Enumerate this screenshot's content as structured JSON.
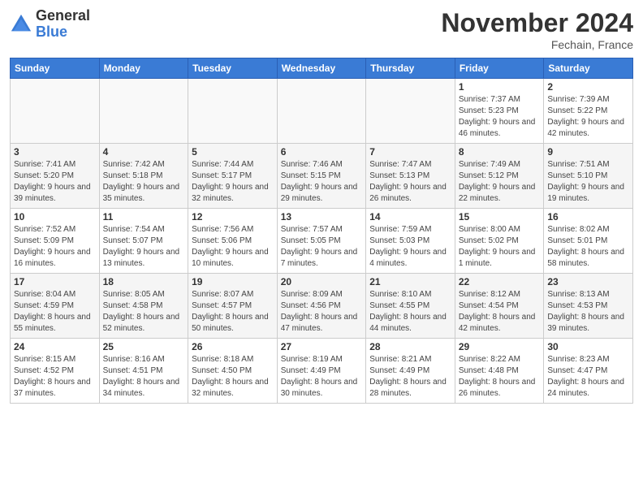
{
  "header": {
    "logo": {
      "general": "General",
      "blue": "Blue"
    },
    "title": "November 2024",
    "location": "Fechain, France"
  },
  "weekdays": [
    "Sunday",
    "Monday",
    "Tuesday",
    "Wednesday",
    "Thursday",
    "Friday",
    "Saturday"
  ],
  "weeks": [
    [
      {
        "day": "",
        "info": ""
      },
      {
        "day": "",
        "info": ""
      },
      {
        "day": "",
        "info": ""
      },
      {
        "day": "",
        "info": ""
      },
      {
        "day": "",
        "info": ""
      },
      {
        "day": "1",
        "info": "Sunrise: 7:37 AM\nSunset: 5:23 PM\nDaylight: 9 hours and 46 minutes."
      },
      {
        "day": "2",
        "info": "Sunrise: 7:39 AM\nSunset: 5:22 PM\nDaylight: 9 hours and 42 minutes."
      }
    ],
    [
      {
        "day": "3",
        "info": "Sunrise: 7:41 AM\nSunset: 5:20 PM\nDaylight: 9 hours and 39 minutes."
      },
      {
        "day": "4",
        "info": "Sunrise: 7:42 AM\nSunset: 5:18 PM\nDaylight: 9 hours and 35 minutes."
      },
      {
        "day": "5",
        "info": "Sunrise: 7:44 AM\nSunset: 5:17 PM\nDaylight: 9 hours and 32 minutes."
      },
      {
        "day": "6",
        "info": "Sunrise: 7:46 AM\nSunset: 5:15 PM\nDaylight: 9 hours and 29 minutes."
      },
      {
        "day": "7",
        "info": "Sunrise: 7:47 AM\nSunset: 5:13 PM\nDaylight: 9 hours and 26 minutes."
      },
      {
        "day": "8",
        "info": "Sunrise: 7:49 AM\nSunset: 5:12 PM\nDaylight: 9 hours and 22 minutes."
      },
      {
        "day": "9",
        "info": "Sunrise: 7:51 AM\nSunset: 5:10 PM\nDaylight: 9 hours and 19 minutes."
      }
    ],
    [
      {
        "day": "10",
        "info": "Sunrise: 7:52 AM\nSunset: 5:09 PM\nDaylight: 9 hours and 16 minutes."
      },
      {
        "day": "11",
        "info": "Sunrise: 7:54 AM\nSunset: 5:07 PM\nDaylight: 9 hours and 13 minutes."
      },
      {
        "day": "12",
        "info": "Sunrise: 7:56 AM\nSunset: 5:06 PM\nDaylight: 9 hours and 10 minutes."
      },
      {
        "day": "13",
        "info": "Sunrise: 7:57 AM\nSunset: 5:05 PM\nDaylight: 9 hours and 7 minutes."
      },
      {
        "day": "14",
        "info": "Sunrise: 7:59 AM\nSunset: 5:03 PM\nDaylight: 9 hours and 4 minutes."
      },
      {
        "day": "15",
        "info": "Sunrise: 8:00 AM\nSunset: 5:02 PM\nDaylight: 9 hours and 1 minute."
      },
      {
        "day": "16",
        "info": "Sunrise: 8:02 AM\nSunset: 5:01 PM\nDaylight: 8 hours and 58 minutes."
      }
    ],
    [
      {
        "day": "17",
        "info": "Sunrise: 8:04 AM\nSunset: 4:59 PM\nDaylight: 8 hours and 55 minutes."
      },
      {
        "day": "18",
        "info": "Sunrise: 8:05 AM\nSunset: 4:58 PM\nDaylight: 8 hours and 52 minutes."
      },
      {
        "day": "19",
        "info": "Sunrise: 8:07 AM\nSunset: 4:57 PM\nDaylight: 8 hours and 50 minutes."
      },
      {
        "day": "20",
        "info": "Sunrise: 8:09 AM\nSunset: 4:56 PM\nDaylight: 8 hours and 47 minutes."
      },
      {
        "day": "21",
        "info": "Sunrise: 8:10 AM\nSunset: 4:55 PM\nDaylight: 8 hours and 44 minutes."
      },
      {
        "day": "22",
        "info": "Sunrise: 8:12 AM\nSunset: 4:54 PM\nDaylight: 8 hours and 42 minutes."
      },
      {
        "day": "23",
        "info": "Sunrise: 8:13 AM\nSunset: 4:53 PM\nDaylight: 8 hours and 39 minutes."
      }
    ],
    [
      {
        "day": "24",
        "info": "Sunrise: 8:15 AM\nSunset: 4:52 PM\nDaylight: 8 hours and 37 minutes."
      },
      {
        "day": "25",
        "info": "Sunrise: 8:16 AM\nSunset: 4:51 PM\nDaylight: 8 hours and 34 minutes."
      },
      {
        "day": "26",
        "info": "Sunrise: 8:18 AM\nSunset: 4:50 PM\nDaylight: 8 hours and 32 minutes."
      },
      {
        "day": "27",
        "info": "Sunrise: 8:19 AM\nSunset: 4:49 PM\nDaylight: 8 hours and 30 minutes."
      },
      {
        "day": "28",
        "info": "Sunrise: 8:21 AM\nSunset: 4:49 PM\nDaylight: 8 hours and 28 minutes."
      },
      {
        "day": "29",
        "info": "Sunrise: 8:22 AM\nSunset: 4:48 PM\nDaylight: 8 hours and 26 minutes."
      },
      {
        "day": "30",
        "info": "Sunrise: 8:23 AM\nSunset: 4:47 PM\nDaylight: 8 hours and 24 minutes."
      }
    ]
  ]
}
